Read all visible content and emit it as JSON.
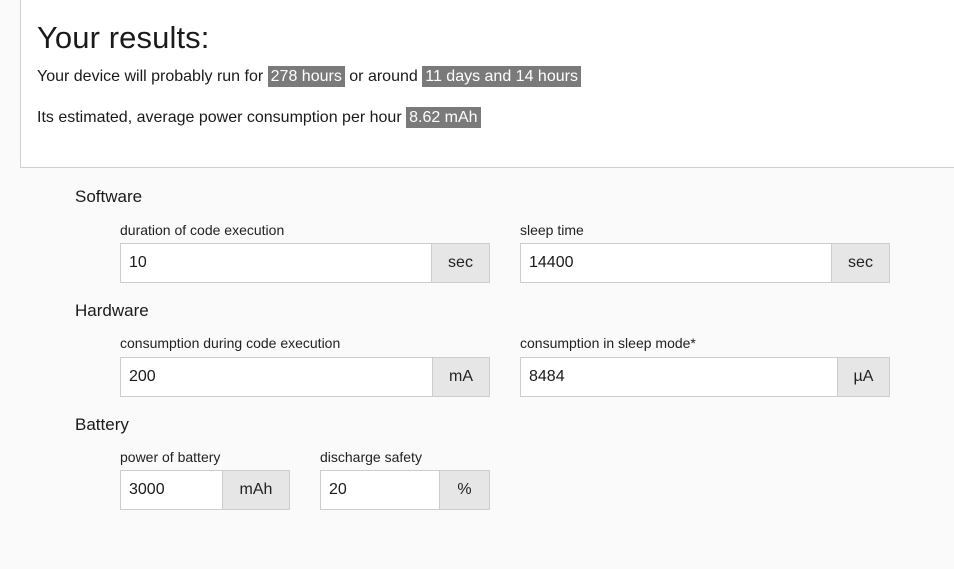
{
  "results": {
    "title": "Your results:",
    "line1_prefix": "Your device will probably run for",
    "runtime_hours": "278 hours",
    "line1_middle": "or around",
    "runtime_days": "11 days and 14 hours",
    "line2_prefix": "Its estimated, average power consumption per hour",
    "avg_consumption": "8.62 mAh"
  },
  "software": {
    "title": "Software",
    "code_duration": {
      "label": "duration of code execution",
      "value": "10",
      "unit": "sec"
    },
    "sleep_time": {
      "label": "sleep time",
      "value": "14400",
      "unit": "sec"
    }
  },
  "hardware": {
    "title": "Hardware",
    "exec_consumption": {
      "label": "consumption during code execution",
      "value": "200",
      "unit": "mA"
    },
    "sleep_consumption": {
      "label": "consumption in sleep mode*",
      "value": "8484",
      "unit": "µA"
    }
  },
  "battery": {
    "title": "Battery",
    "capacity": {
      "label": "power of battery",
      "value": "3000",
      "unit": "mAh"
    },
    "discharge_safety": {
      "label": "discharge safety",
      "value": "20",
      "unit": "%"
    }
  },
  "colors": {
    "highlight": "#7a7a7a",
    "unit_bg": "#e6e6e6",
    "page_bg": "#fafafa"
  }
}
